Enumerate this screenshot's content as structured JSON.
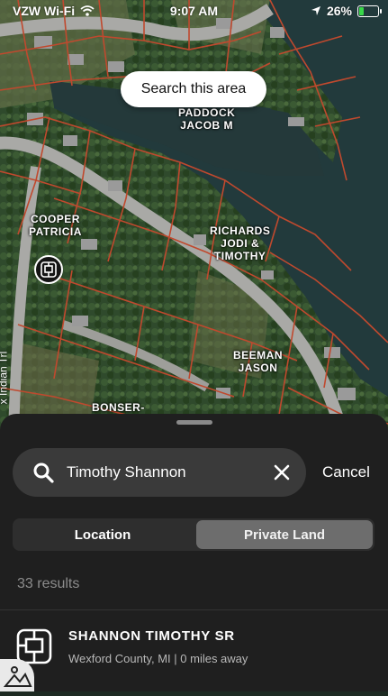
{
  "status_bar": {
    "carrier": "VZW Wi-Fi",
    "time": "9:07 AM",
    "battery": "26%",
    "battery_level": 0.26
  },
  "map": {
    "search_area_label": "Search this area",
    "road_label": "x Indian Trl",
    "owners": [
      {
        "name": "PADDOCK\nJACOB M"
      },
      {
        "name": "COOPER\nPATRICIA"
      },
      {
        "name": "RICHARDS\nJODI &\nTIMOTHY"
      },
      {
        "name": "BEEMAN\nJASON"
      },
      {
        "name": "BONSER-"
      }
    ],
    "colors": {
      "parcel_line": "#c0492e",
      "water": "#223a3c",
      "vegetation": "#2f4a2c"
    }
  },
  "sheet": {
    "search": {
      "value": "Timothy Shannon",
      "placeholder": "Search"
    },
    "cancel_label": "Cancel",
    "tabs": [
      {
        "label": "Location",
        "selected": false
      },
      {
        "label": "Private Land",
        "selected": true
      }
    ],
    "results_count": "33 results",
    "results": [
      {
        "title": "SHANNON TIMOTHY SR",
        "subtitle": "Wexford County, MI | 0 miles away",
        "icon": "parcel-icon"
      }
    ]
  }
}
